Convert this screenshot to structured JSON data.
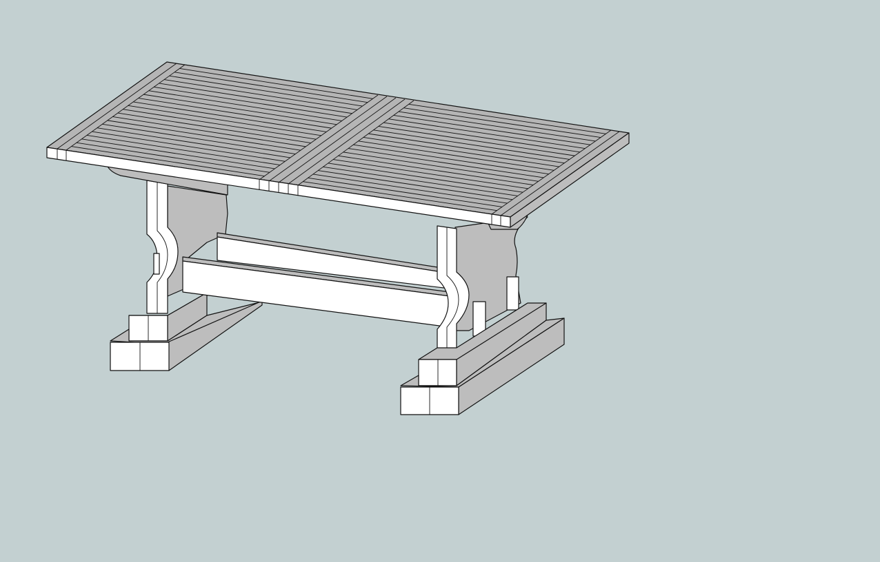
{
  "viewport": {
    "background": "#c3d0d1",
    "model": "trestle-table",
    "colors": {
      "top_face": "#b5b5b5",
      "light_face": "#ffffff",
      "shadow_face": "#bdbdbd",
      "edge": "#111111"
    }
  }
}
